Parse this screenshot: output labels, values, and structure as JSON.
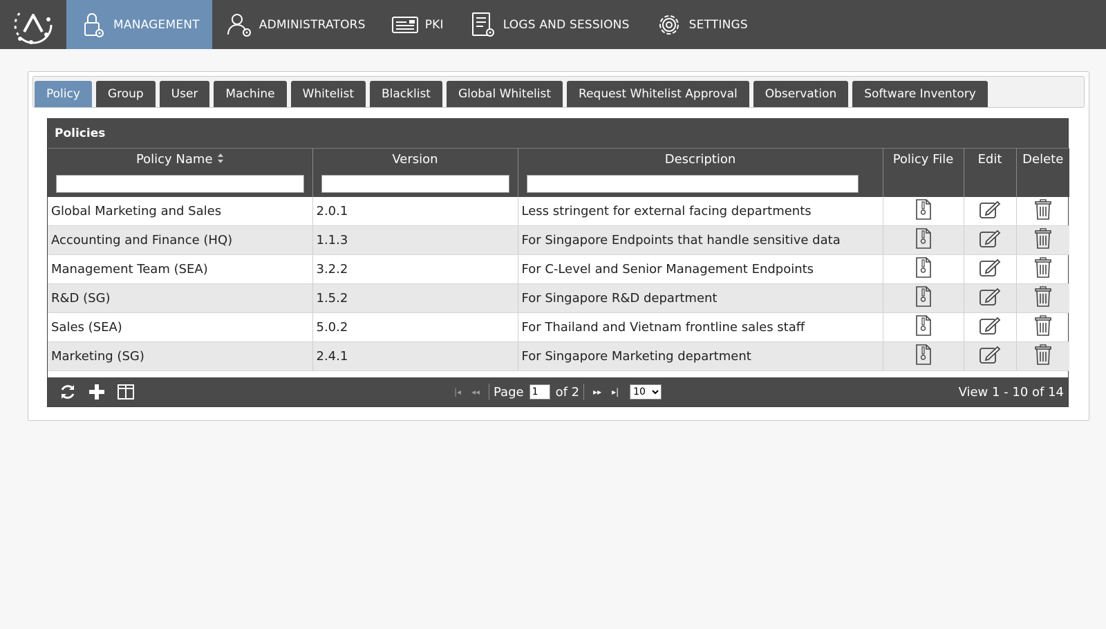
{
  "nav": {
    "items": [
      {
        "label": "MANAGEMENT",
        "icon": "lock-gear-icon",
        "active": true
      },
      {
        "label": "ADMINISTRATORS",
        "icon": "user-gear-icon",
        "active": false
      },
      {
        "label": "PKI",
        "icon": "certificate-icon",
        "active": false
      },
      {
        "label": "LOGS AND SESSIONS",
        "icon": "log-gear-icon",
        "active": false
      },
      {
        "label": "SETTINGS",
        "icon": "gear-icon",
        "active": false
      }
    ]
  },
  "tabs": [
    {
      "label": "Policy",
      "active": true
    },
    {
      "label": "Group"
    },
    {
      "label": "User"
    },
    {
      "label": "Machine"
    },
    {
      "label": "Whitelist"
    },
    {
      "label": "Blacklist"
    },
    {
      "label": "Global Whitelist"
    },
    {
      "label": "Request Whitelist Approval"
    },
    {
      "label": "Observation"
    },
    {
      "label": "Software Inventory"
    }
  ],
  "grid": {
    "title": "Policies",
    "columns": {
      "policy_name": "Policy Name",
      "version": "Version",
      "description": "Description",
      "policy_file": "Policy File",
      "edit": "Edit",
      "delete": "Delete"
    },
    "filters": {
      "policy_name": "",
      "version": "",
      "description": ""
    },
    "rows": [
      {
        "name": "Global Marketing and Sales",
        "version": "2.0.1",
        "description": "Less stringent for external facing departments"
      },
      {
        "name": "Accounting and Finance (HQ)",
        "version": "1.1.3",
        "description": "For Singapore Endpoints that handle sensitive data"
      },
      {
        "name": "Management Team (SEA)",
        "version": "3.2.2",
        "description": "For C-Level and Senior Management Endpoints"
      },
      {
        "name": "R&D (SG)",
        "version": "1.5.2",
        "description": "For Singapore R&D department"
      },
      {
        "name": "Sales (SEA)",
        "version": "5.0.2",
        "description": "For Thailand and Vietnam frontline sales staff"
      },
      {
        "name": "Marketing (SG)",
        "version": "2.4.1",
        "description": "For Singapore Marketing department"
      }
    ]
  },
  "pager": {
    "page_label": "Page",
    "page_value": "1",
    "of_label": "of 2",
    "page_size": "10",
    "view_text": "View 1 - 10 of 14"
  }
}
